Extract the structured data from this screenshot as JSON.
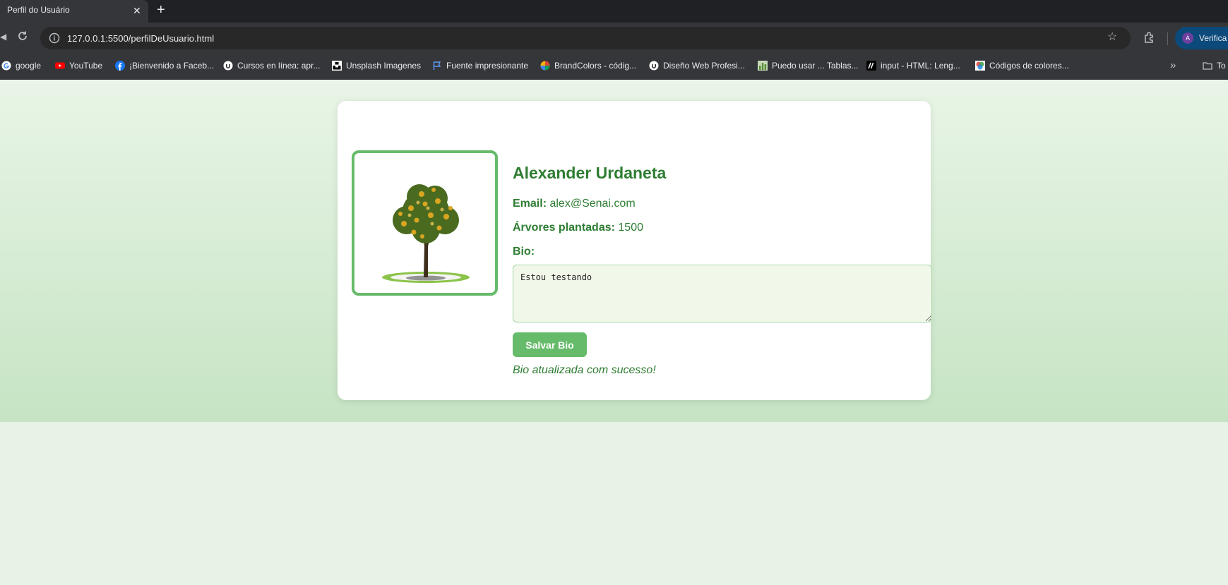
{
  "browser": {
    "tab_title": "Perfil do Usuário",
    "tab_close": "✕",
    "new_tab": "+",
    "url": "127.0.0.1:5500/perfilDeUsuario.html",
    "profile_initial": "A",
    "profile_label": "Verifica",
    "bookmarks_more": "»",
    "bookmarks_folder": "To",
    "bookmarks": [
      {
        "label": "google",
        "icon": "google-icon"
      },
      {
        "label": "YouTube",
        "icon": "youtube-icon"
      },
      {
        "label": "¡Bienvenido a Faceb...",
        "icon": "facebook-icon"
      },
      {
        "label": "Cursos en línea: apr...",
        "icon": "udemy-icon"
      },
      {
        "label": "Unsplash Imagenes",
        "icon": "unsplash-icon"
      },
      {
        "label": "Fuente impresionante",
        "icon": "flag-icon"
      },
      {
        "label": "BrandColors - códig...",
        "icon": "brandcolors-icon"
      },
      {
        "label": "Diseño Web Profesi...",
        "icon": "udemy-icon"
      },
      {
        "label": "Puedo usar ... Tablas...",
        "icon": "caniuse-icon"
      },
      {
        "label": "input - HTML: Leng...",
        "icon": "mdn-icon"
      },
      {
        "label": "Códigos de colores...",
        "icon": "color-wheel-icon"
      }
    ]
  },
  "profile": {
    "name": "Alexander Urdaneta",
    "email_label": "Email:",
    "email": "alex@Senai.com",
    "trees_label": "Árvores plantadas:",
    "trees": "1500",
    "bio_label": "Bio:",
    "bio_value": "Estou testando",
    "save_button": "Salvar Bio",
    "success_message": "Bio atualizada com sucesso!",
    "avatar_icon": "tree-icon"
  },
  "colors": {
    "primary_green": "#2e7d32",
    "accent_green": "#66bb6a",
    "bio_background": "#f1f8e9"
  }
}
